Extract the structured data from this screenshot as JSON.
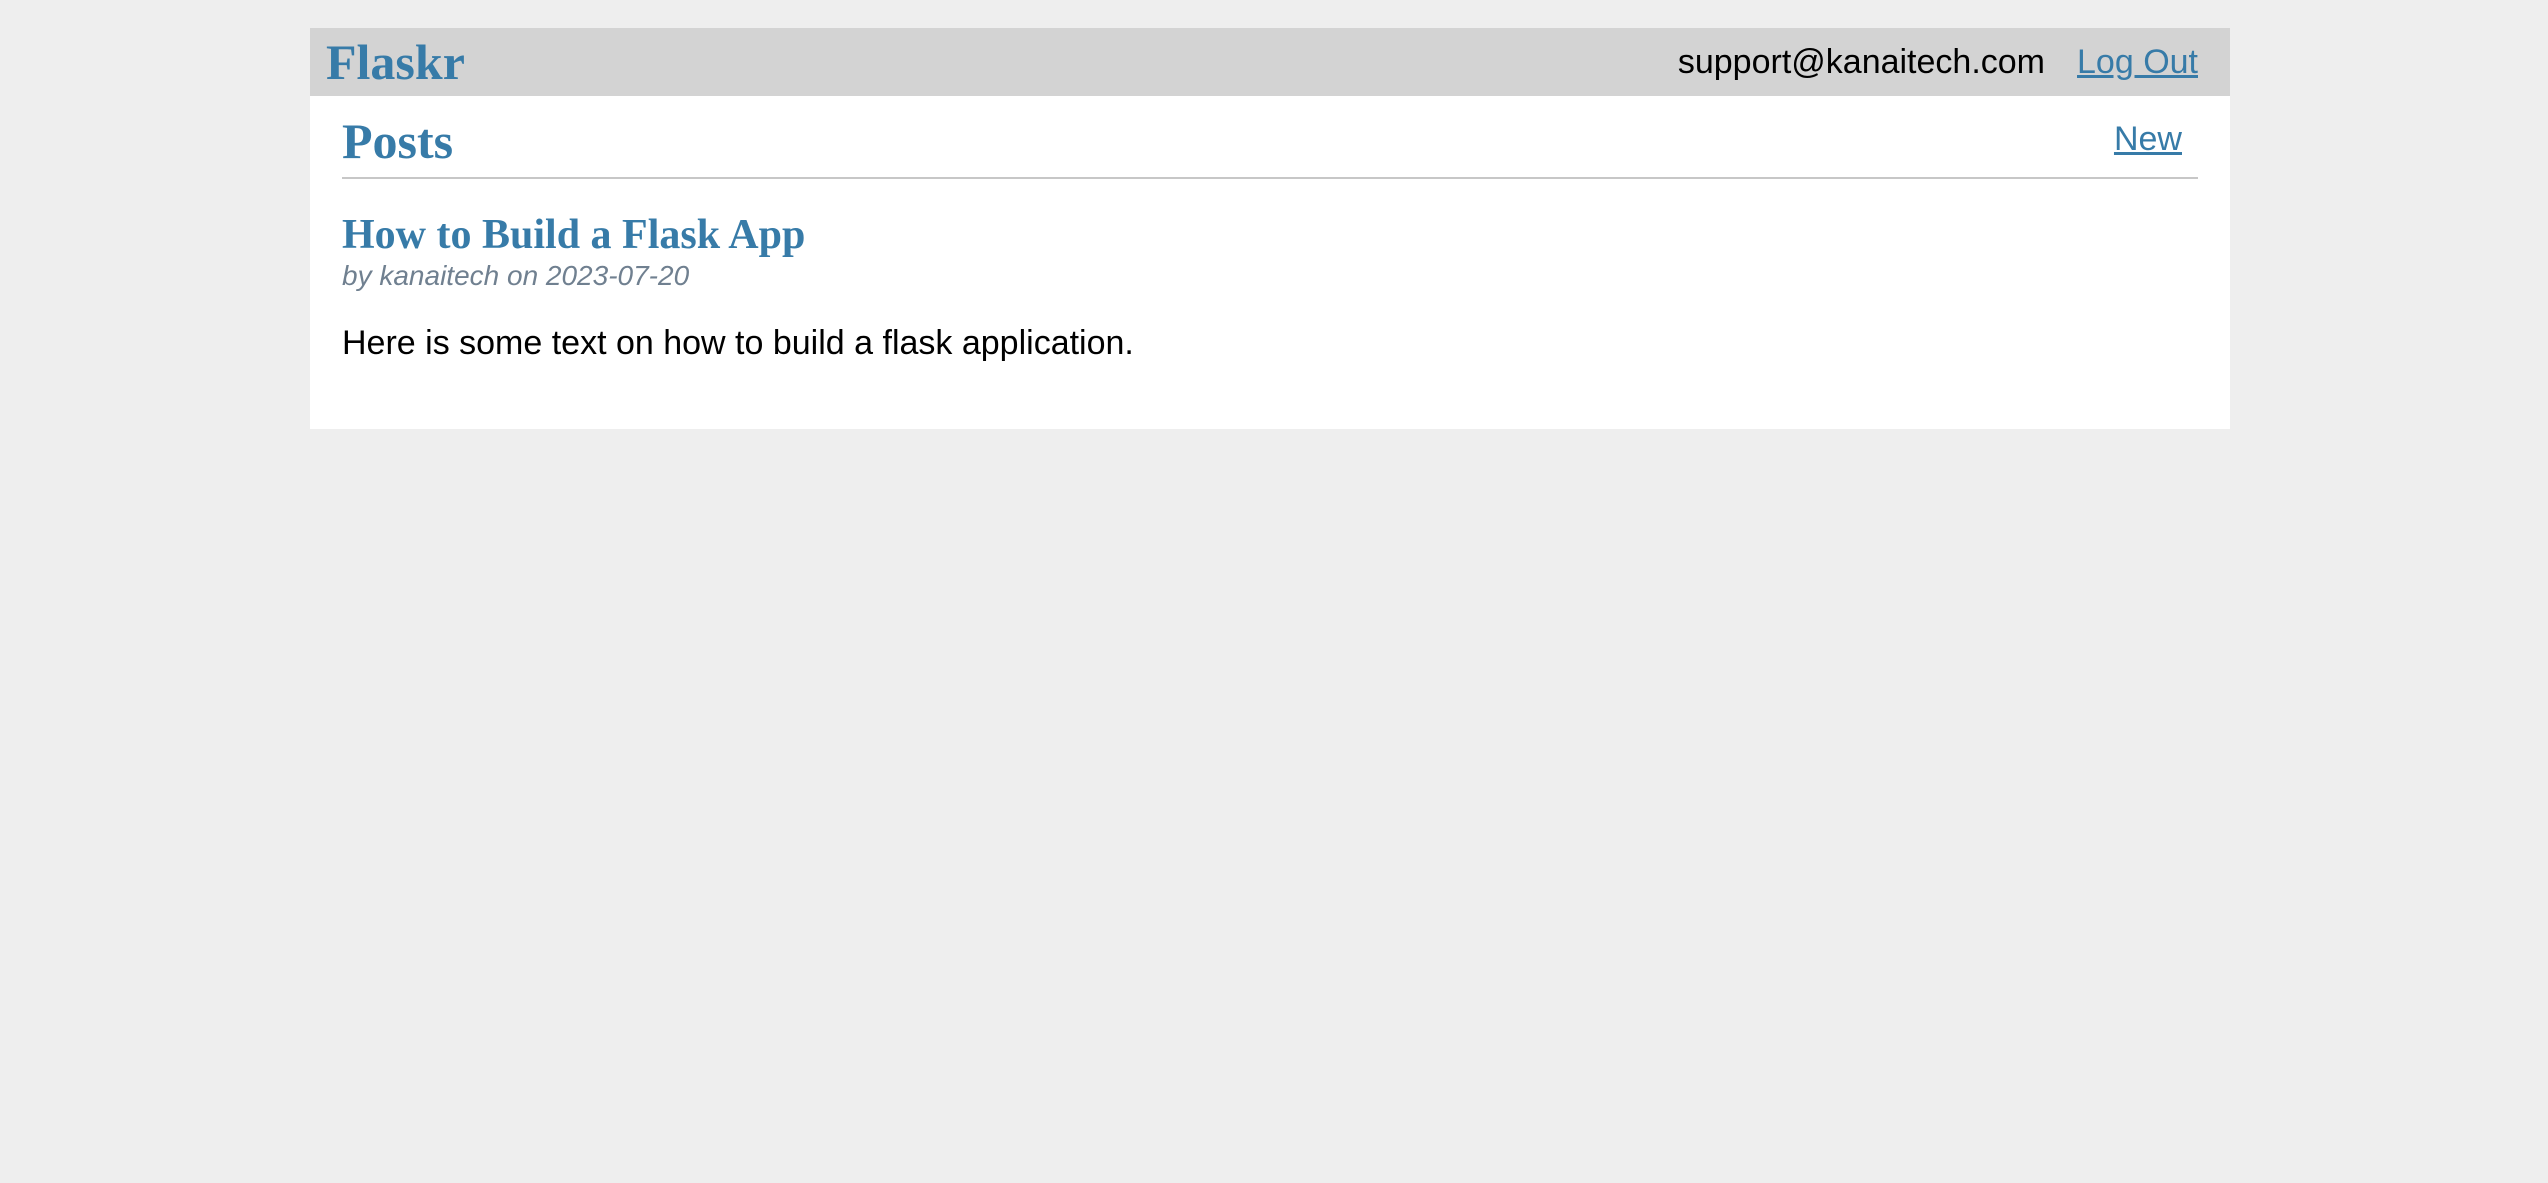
{
  "nav": {
    "brand": "Flaskr",
    "user_email": "support@kanaitech.com",
    "logout_label": "Log Out"
  },
  "header": {
    "title": "Posts",
    "new_label": "New"
  },
  "posts": [
    {
      "title": "How to Build a Flask App",
      "about": "by kanaitech on 2023-07-20",
      "body": "Here is some text on how to build a flask application."
    }
  ],
  "colors": {
    "accent": "#377ba8",
    "nav_background": "#d3d3d3",
    "page_background": "#eeeeee",
    "meta_text": "#708090"
  }
}
